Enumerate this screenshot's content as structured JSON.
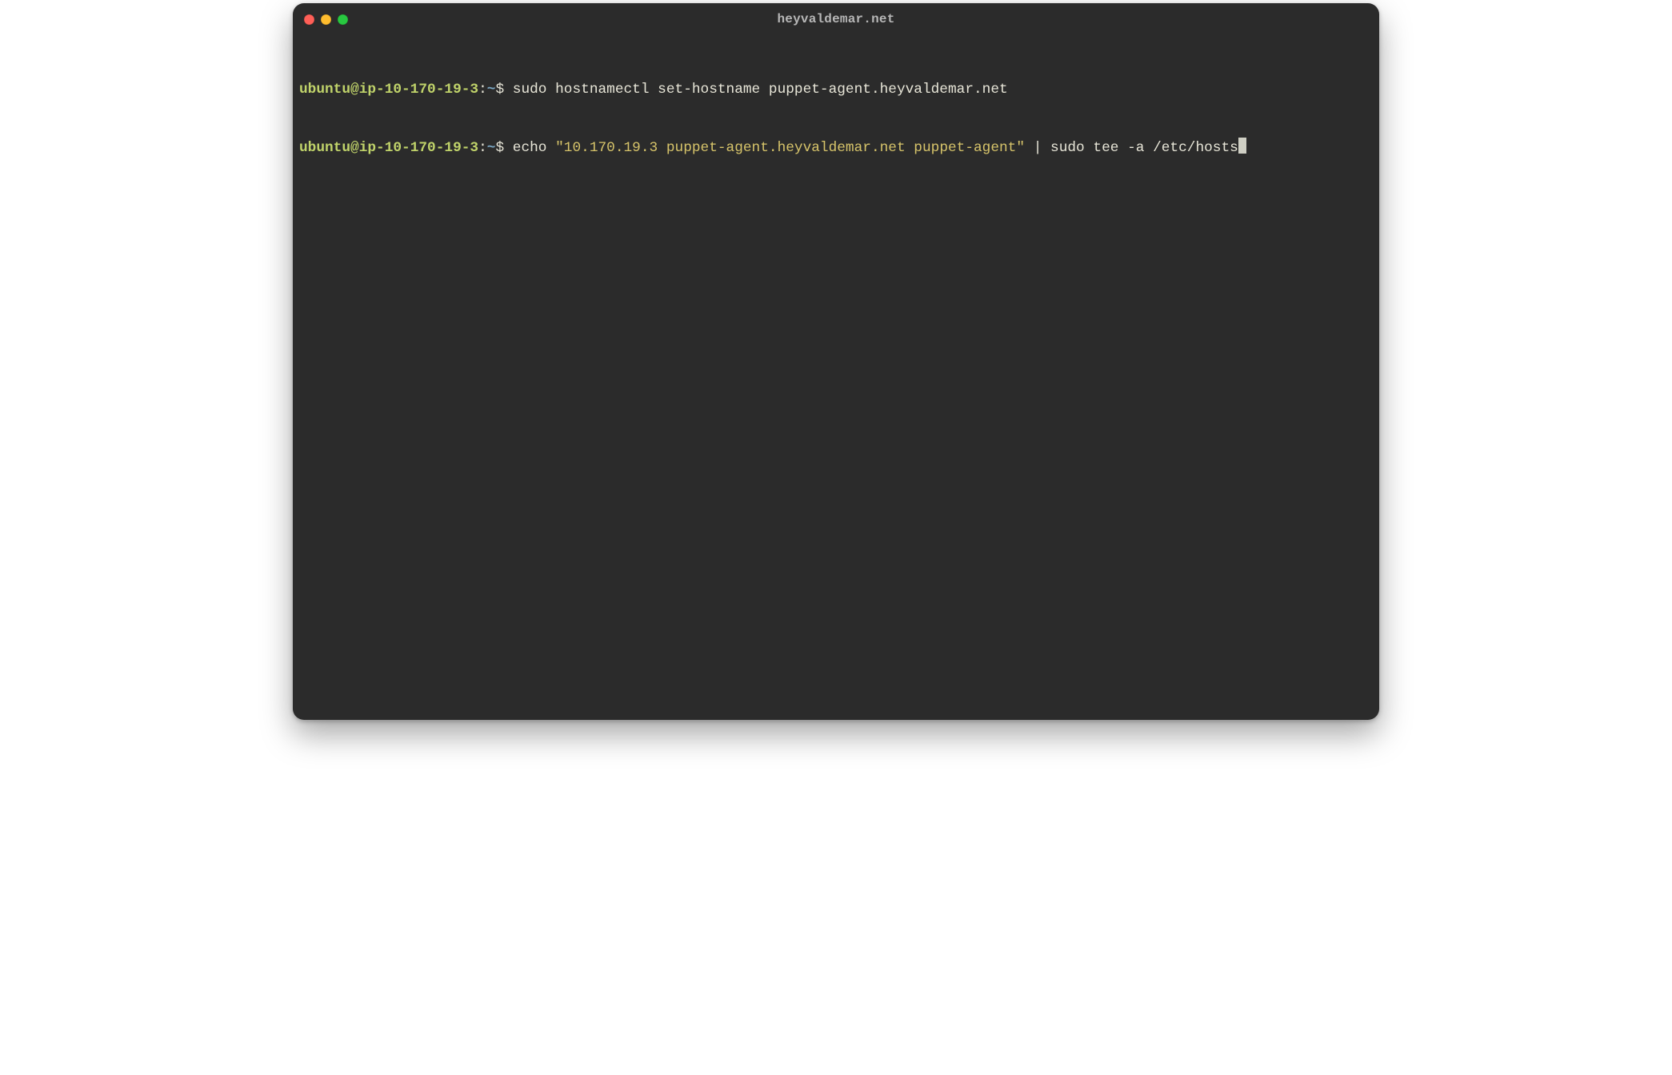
{
  "window": {
    "title": "heyvaldemar.net"
  },
  "colors": {
    "bg": "#2b2b2b",
    "text": "#e8e6d8",
    "prompt_user": "#c0d36a",
    "prompt_path": "#7aa6c2",
    "string": "#d7c46a",
    "titlebar_text": "#b7b7b7",
    "traffic_close": "#ff5f57",
    "traffic_min": "#febc2e",
    "traffic_max": "#28c840"
  },
  "prompt": {
    "user_host": "ubuntu@ip-10-170-19-3",
    "colon": ":",
    "path": "~",
    "symbol": "$"
  },
  "lines": [
    {
      "command_pre": " sudo hostnamectl set-hostname puppet-agent.heyvaldemar.net",
      "quoted": "",
      "command_post": "",
      "has_cursor": false
    },
    {
      "command_pre": " echo ",
      "quoted": "\"10.170.19.3 puppet-agent.heyvaldemar.net puppet-agent\"",
      "command_post": " | sudo tee -a /etc/hosts",
      "has_cursor": true
    }
  ]
}
